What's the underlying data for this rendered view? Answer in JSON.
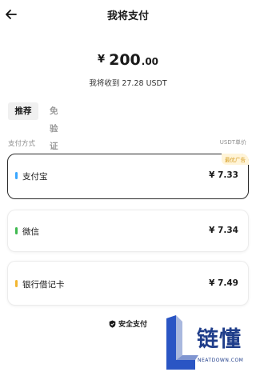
{
  "header": {
    "title": "我将支付"
  },
  "pay": {
    "currency": "¥",
    "amount_int": "200",
    "amount_dec": ".00",
    "receive_text": "我将收到 27.28 USDT"
  },
  "tabs": [
    {
      "label": "推荐",
      "active": true
    },
    {
      "label": "免验证",
      "active": false
    }
  ],
  "methods_section": {
    "label": "支付方式",
    "unit_label": "USDT单价"
  },
  "methods": [
    {
      "name": "支付宝",
      "price": "¥ 7.33",
      "marker_color": "#3aa7ff",
      "badge": "最优广告",
      "selected": true
    },
    {
      "name": "微信",
      "price": "¥ 7.34",
      "marker_color": "#3fb950",
      "selected": false
    },
    {
      "name": "银行借记卡",
      "price": "¥ 7.49",
      "marker_color": "#f2b632",
      "selected": false
    }
  ],
  "footer": {
    "secure_label": "安全支付"
  },
  "watermark": {
    "logo_text": "链懂",
    "sub_text": "NEATDOWN.COM"
  },
  "colors": {
    "accent_badge_bg": "#fff4d8",
    "accent_badge_text": "#d49a1c",
    "watermark": "#1f3d8a"
  }
}
